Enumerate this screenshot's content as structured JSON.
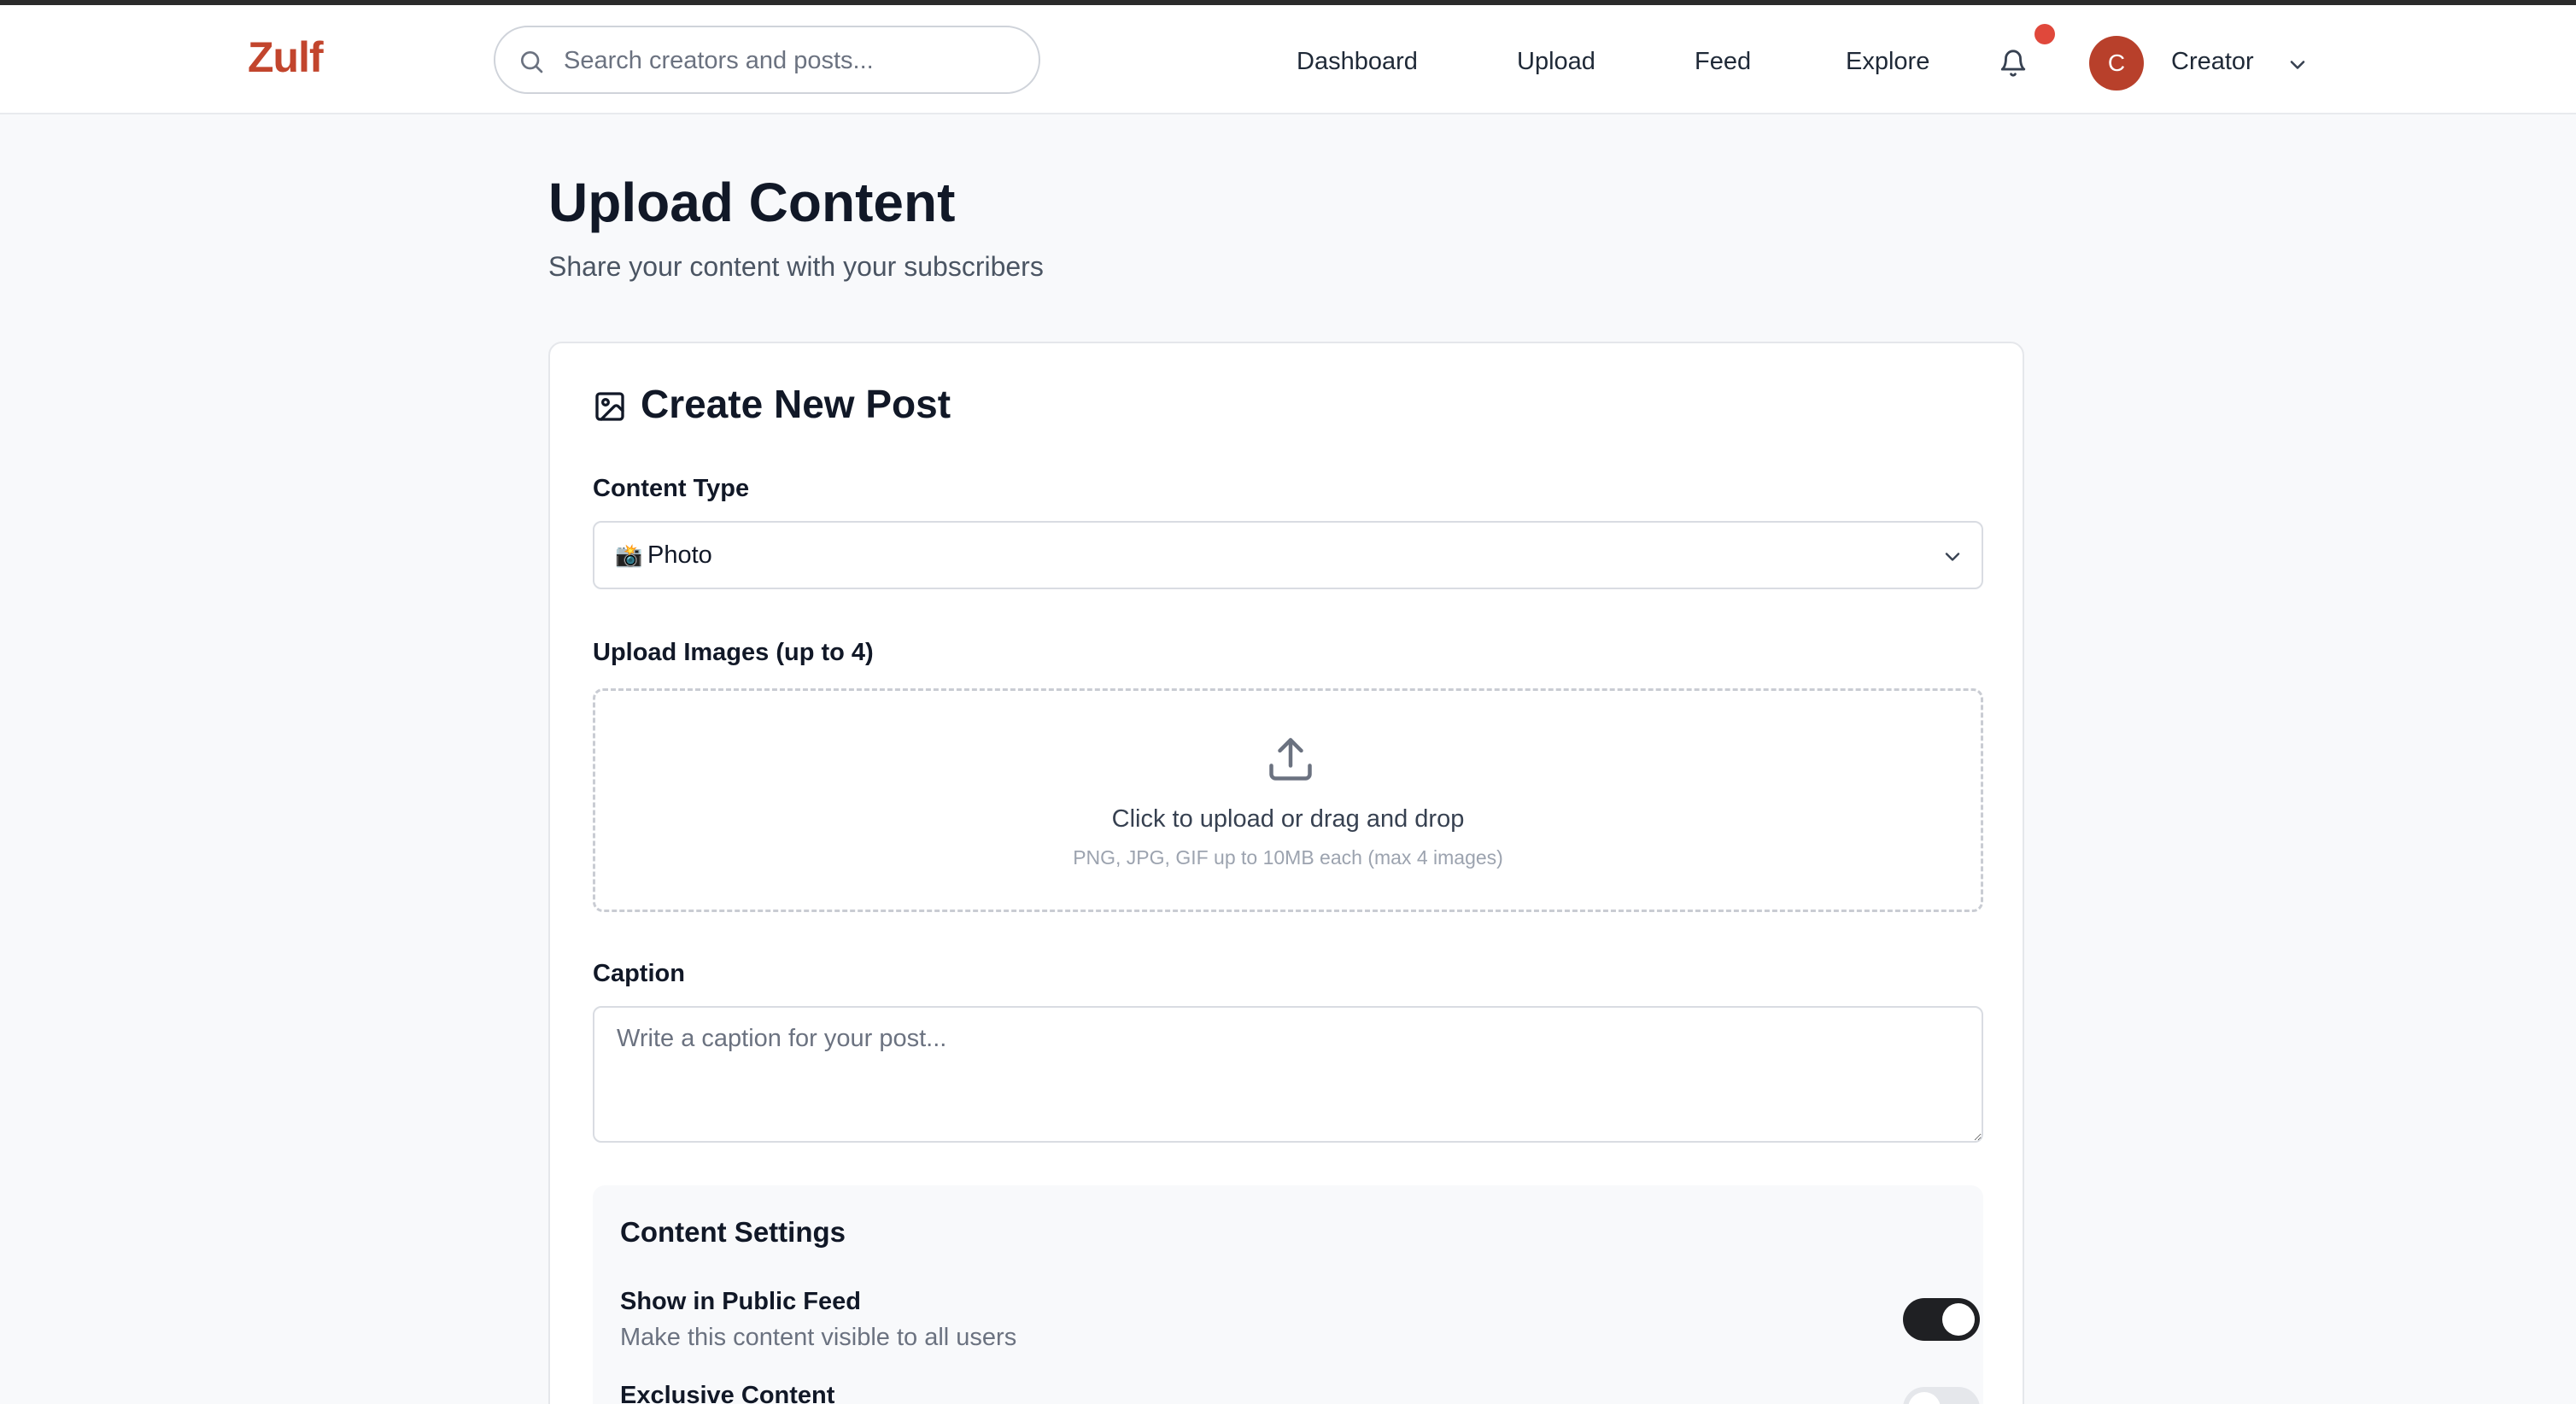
{
  "header": {
    "logo": "Zulf",
    "search_placeholder": "Search creators and posts...",
    "nav": [
      "Dashboard",
      "Upload",
      "Feed",
      "Explore"
    ],
    "user": {
      "initial": "C",
      "name": "Creator"
    },
    "notification_dot_color": "#e0483b"
  },
  "page": {
    "title": "Upload Content",
    "subtitle": "Share your content with your subscribers"
  },
  "form": {
    "title": "Create New Post",
    "content_type": {
      "label": "Content Type",
      "emoji": "📸",
      "selected": "Photo"
    },
    "upload": {
      "label": "Upload Images (up to 4)",
      "main_text": "Click to upload or drag and drop",
      "hint": "PNG, JPG, GIF up to 10MB each (max 4 images)"
    },
    "caption": {
      "label": "Caption",
      "placeholder": "Write a caption for your post..."
    },
    "settings": {
      "title": "Content Settings",
      "options": [
        {
          "title": "Show in Public Feed",
          "description": "Make this content visible to all users",
          "enabled": true
        },
        {
          "title": "Exclusive Content",
          "description": "",
          "enabled": false
        }
      ]
    }
  },
  "colors": {
    "brand": "#c2452d",
    "avatar": "#b8402b",
    "toggle_on": "#1f2023"
  },
  "icons": {
    "search": "search-icon",
    "bell": "bell-icon",
    "chevron": "chevron-down-icon",
    "image": "image-icon",
    "upload": "upload-icon"
  }
}
